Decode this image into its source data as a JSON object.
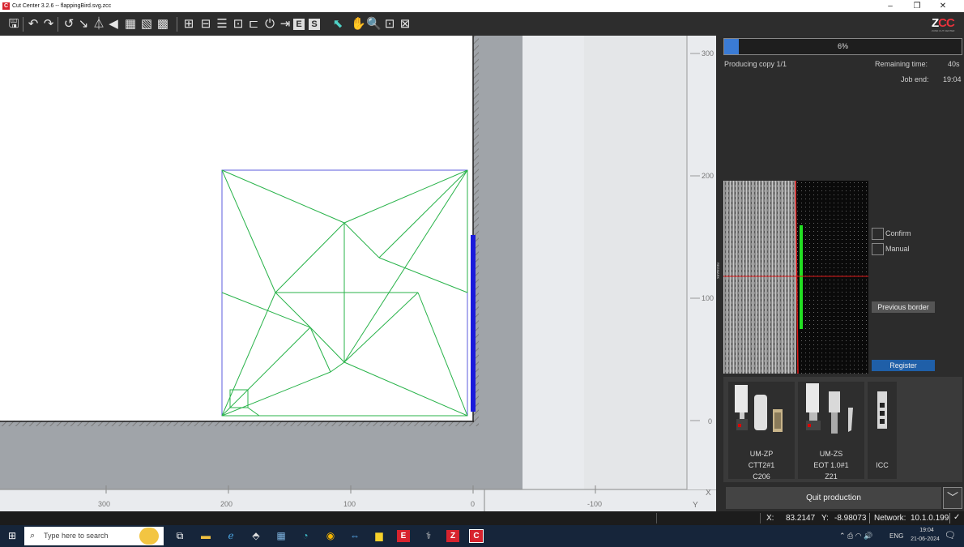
{
  "window": {
    "title": "Cut Center 3.2.6  --  flappingBird.svg.zcc",
    "app_icon_letter": "C",
    "minimize": "–",
    "maximize": "❐",
    "close": "✕"
  },
  "brand": {
    "logo_a": "Z",
    "logo_b": "CC",
    "tagline": "ZUND CUT CENTER"
  },
  "toolbar": {
    "icons": [
      "save-icon",
      "undo-icon",
      "redo-icon",
      "rotate-icon",
      "rotate-small-icon",
      "mirror-icon",
      "flip-icon",
      "nest-icon",
      "edit-nest-icon",
      "delete-nest-icon",
      "layout-icon",
      "align-icon",
      "distribute-icon",
      "fit-page-icon",
      "tile-icon",
      "power-icon",
      "import-icon",
      "e-icon",
      "s-icon",
      "pointer-icon",
      "hand-icon",
      "zoom-icon",
      "zoom-fit-icon",
      "zoom-page-icon"
    ]
  },
  "ruler": {
    "x_labels": [
      "300",
      "200",
      "100",
      "0",
      "-100"
    ],
    "y_labels": [
      "300",
      "200",
      "100",
      "0"
    ],
    "x_axis": "X",
    "y_axis": "Y"
  },
  "production": {
    "progress_percent": 6,
    "progress_label": "6%",
    "status": "Producing copy 1/1",
    "remaining_label": "Remaining time:",
    "remaining_value": "40s",
    "job_end_label": "Job end:",
    "job_end_value": "19:04"
  },
  "registration": {
    "confirm_label": "Confirm",
    "manual_label": "Manual",
    "previous_border_label": "Previous border",
    "register_label": "Register",
    "camera_side_text": "REGMARK"
  },
  "tools": [
    {
      "name": "UM-ZP",
      "insert": "CTT2#1",
      "code": "C206"
    },
    {
      "name": "UM-ZS",
      "insert": "EOT 1.0#1",
      "code": "Z21"
    },
    {
      "name": "ICC",
      "insert": "",
      "code": ""
    }
  ],
  "quit_label": "Quit production",
  "quit_dropdown": "﹀",
  "statusbar": {
    "x_label": "X:",
    "x_value": "83.2147",
    "y_label": "Y:",
    "y_value": "-8.98073",
    "network_label": "Network:",
    "network_value": "10.1.0.199",
    "check": "✓"
  },
  "taskbar": {
    "search_placeholder": "Type here to search",
    "lang": "ENG",
    "time": "19:04",
    "date": "21-06-2024"
  }
}
